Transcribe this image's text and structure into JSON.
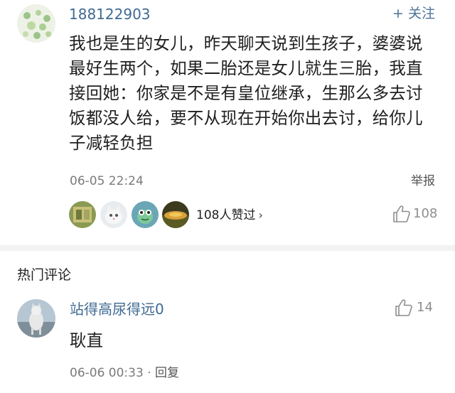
{
  "top_comment": {
    "username": "188122903",
    "follow_label": "+ 关注",
    "text": "我也是生的女儿，昨天聊天说到生孩子，婆婆说最好生两个，如果二胎还是女儿就生三胎，我直接回她：你家是不是有皇位继承，生那么多去讨饭都没人给，要不从现在开始你出去讨，给你儿子减轻负担",
    "timestamp": "06-05 22:24",
    "report_label": "举报",
    "likers_summary": "108人赞过",
    "chevron": "›",
    "like_count": "108"
  },
  "hot_section": {
    "title": "热门评论"
  },
  "reply": {
    "username": "站得高尿得远0",
    "text": "耿直",
    "timestamp": "06-06 00:33",
    "separator": " · ",
    "reply_label": "回复",
    "like_count": "14"
  },
  "colors": {
    "username": "#3f6a93",
    "follow": "#4d7399",
    "meta_gray": "#7b7b7b",
    "like_gray": "#8e8e8e",
    "divider": "#f2f2f2"
  }
}
